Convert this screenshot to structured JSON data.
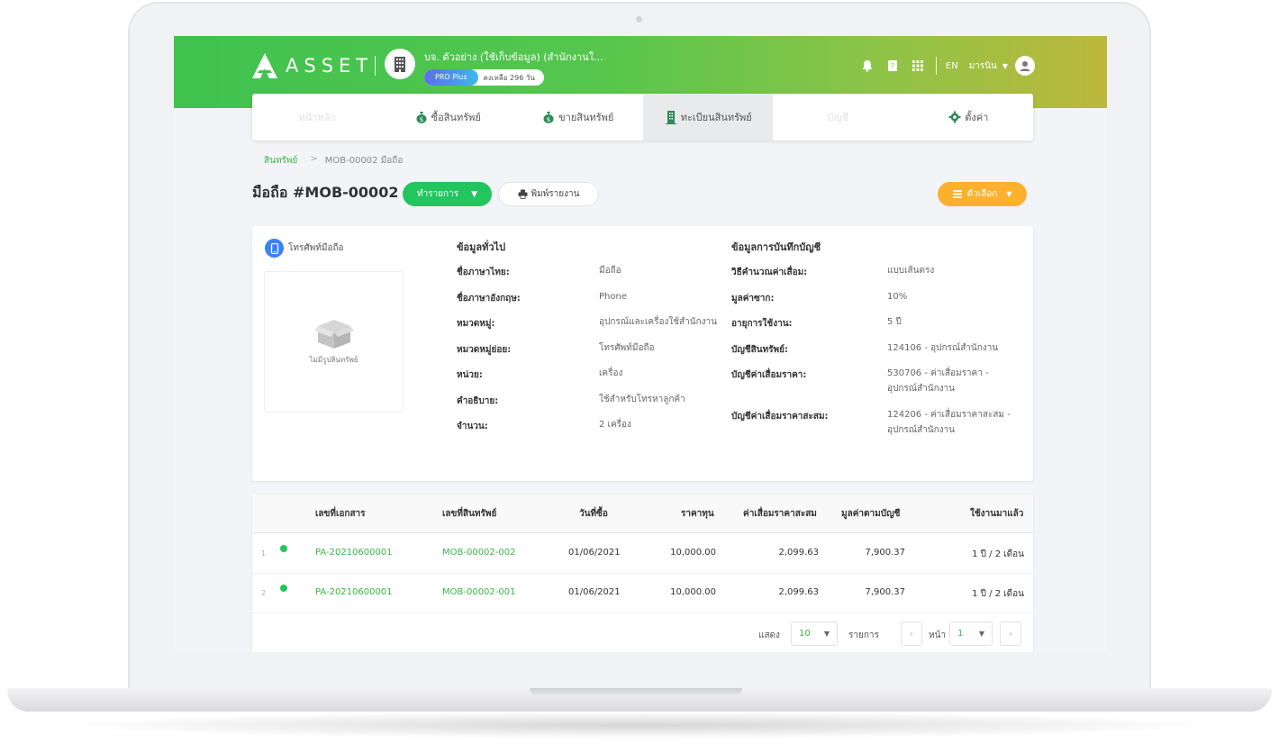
{
  "header": {
    "logo_text": "ASSET",
    "company_name": "บจ. ตัวอย่าง (ใช้เก็บข้อมูล) (สำนักงานใ...",
    "plan": "PRO Plus",
    "plan_remaining": "คงเหลือ 296 วัน",
    "language": "EN",
    "user_name": "มารนิน"
  },
  "nav": {
    "items": [
      {
        "label": "หน้าหลัก",
        "icon": "home-icon"
      },
      {
        "label": "ซื้อสินทรัพย์",
        "icon": "money-bag-icon"
      },
      {
        "label": "ขายสินทรัพย์",
        "icon": "money-bag-icon"
      },
      {
        "label": "ทะเบียนสินทรัพย์",
        "icon": "building-icon"
      },
      {
        "label": "บัญชี",
        "icon": "book-icon"
      },
      {
        "label": "ตั้งค่า",
        "icon": "gear-icon"
      }
    ],
    "active_index": 3
  },
  "breadcrumb": {
    "parent": "สินทรัพย์",
    "separator": ">",
    "current": "MOB-00002 มือถือ"
  },
  "page": {
    "title": "มือถือ #MOB-00002",
    "action_label": "ทำรายการ",
    "print_label": "พิมพ์รายงาน",
    "options_label": "ตัวเลือก"
  },
  "asset": {
    "type_label": "โทรศัพท์มือถือ",
    "no_image_label": "ไม่มีรูปสินทรัพย์"
  },
  "general": {
    "title": "ข้อมูลทั่วไป",
    "rows": [
      {
        "label": "ชื่อภาษาไทย:",
        "value": "มือถือ"
      },
      {
        "label": "ชื่อภาษาอังกฤษ:",
        "value": "Phone"
      },
      {
        "label": "หมวดหมู่:",
        "value": "อุปกรณ์และเครื่องใช้สำนักงาน"
      },
      {
        "label": "หมวดหมู่ย่อย:",
        "value": "โทรศัพท์มือถือ"
      },
      {
        "label": "หน่วย:",
        "value": "เครื่อง"
      },
      {
        "label": "คำอธิบาย:",
        "value": "ใช้สำหรับโทรหาลูกค้า"
      },
      {
        "label": "จำนวน:",
        "value": "2 เครื่อง"
      }
    ]
  },
  "accounting": {
    "title": "ข้อมูลการบันทึกบัญชี",
    "rows": [
      {
        "label": "วิธีคำนวณค่าเสื่อม:",
        "value": "แบบเส้นตรง",
        "value2": ""
      },
      {
        "label": "มูลค่าซาก:",
        "value": "10%",
        "value2": ""
      },
      {
        "label": "อายุการใช้งาน:",
        "value": "5 ปี",
        "value2": ""
      },
      {
        "label": "บัญชีสินทรัพย์:",
        "value": "124106 - อุปกรณ์สำนักงาน",
        "value2": ""
      },
      {
        "label": "บัญชีค่าเสื่อมราคา:",
        "value": "530706 - ค่าเสื่อมราคา -",
        "value2": "อุปกรณ์สำนักงาน"
      },
      {
        "label": "บัญชีค่าเสื่อมราคาสะสม:",
        "value": "124206 - ค่าเสื่อมราคาสะสม -",
        "value2": "อุปกรณ์สำนักงาน"
      }
    ]
  },
  "table": {
    "columns": [
      "เลขที่เอกสาร",
      "เลขที่สินทรัพย์",
      "วันที่ซื้อ",
      "ราคาทุน",
      "ค่าเสื่อมราคาสะสม",
      "มูลค่าตามบัญชี",
      "ใช้งานมาแล้ว"
    ],
    "rows": [
      {
        "index": "1",
        "doc": "PA-20210600001",
        "asset_no": "MOB-00002-002",
        "date": "01/06/2021",
        "cost": "10,000.00",
        "accum": "2,099.63",
        "book": "7,900.37",
        "used": "1 ปี / 2 เดือน",
        "status_color": "#22c55e"
      },
      {
        "index": "2",
        "doc": "PA-20210600001",
        "asset_no": "MOB-00002-001",
        "date": "01/06/2021",
        "cost": "10,000.00",
        "accum": "2,099.63",
        "book": "7,900.37",
        "used": "1 ปี / 2 เดือน",
        "status_color": "#22c55e"
      }
    ]
  },
  "pagination": {
    "show_label": "แสดง",
    "page_size": "10",
    "items_label": "รายการ",
    "page_label": "หน้า",
    "page": "1"
  }
}
